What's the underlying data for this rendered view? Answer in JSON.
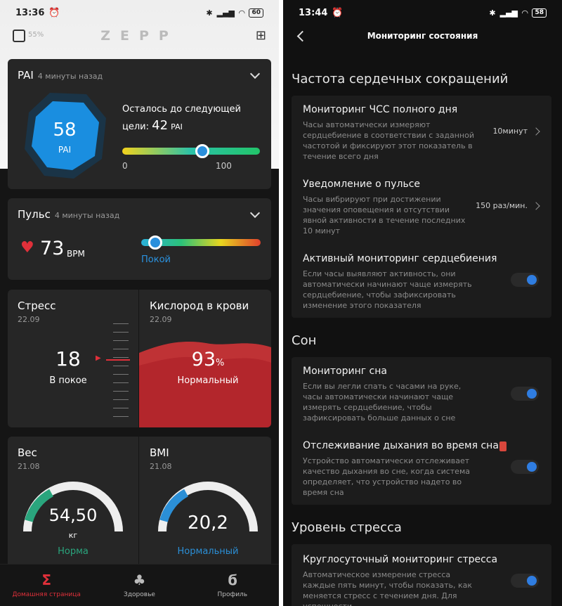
{
  "left": {
    "status": {
      "time": "13:36",
      "battery": "60"
    },
    "header": {
      "logo": "ZEPP",
      "device_battery": "55%"
    },
    "pai": {
      "title": "PAI",
      "time": "4 минуты назад",
      "value": "58",
      "unit": "PAI",
      "goal_text": "Осталось до следующей",
      "goal_prefix": "цели:",
      "goal_value": "42",
      "goal_unit": "PAI",
      "min": "0",
      "max": "100",
      "progress": 0.58
    },
    "pulse": {
      "title": "Пульс",
      "time": "4 минуты назад",
      "value": "73",
      "unit": "BPM",
      "status": "Покой",
      "level": 0.12
    },
    "stress": {
      "title": "Стресс",
      "date": "22.09",
      "value": "18",
      "status": "В покое"
    },
    "oxygen": {
      "title": "Кислород в крови",
      "date": "22.09",
      "value": "93",
      "unit": "%",
      "status": "Нормальный"
    },
    "weight": {
      "title": "Вес",
      "date": "21.08",
      "value": "54,50",
      "unit": "кг",
      "status": "Норма"
    },
    "bmi": {
      "title": "BMI",
      "date": "21.08",
      "value": "20,2",
      "status": "Нормальный"
    },
    "tabs": [
      {
        "label": "Домашняя страница",
        "icon": "Σ"
      },
      {
        "label": "Здоровье",
        "icon": "♣"
      },
      {
        "label": "Профиль",
        "icon": "ϭ"
      }
    ]
  },
  "right": {
    "status": {
      "time": "13:44",
      "battery": "58"
    },
    "title": "Мониторинг состояния",
    "sec1": "Частота сердечных сокращений",
    "hr_all_day": {
      "title": "Мониторинг ЧСС полного дня",
      "desc": "Часы автоматически измеряют сердцебиение в соответствии с заданной частотой и фиксируют этот показатель в течение всего дня",
      "value": "10минут"
    },
    "pulse_alert": {
      "title": "Уведомление о пульсе",
      "desc": "Часы вибрируют при достижении значения оповещения и отсутствии явной активности в течение последних 10 минут",
      "value": "150 раз/мин."
    },
    "active_hr": {
      "title": "Активный мониторинг сердцебиения",
      "desc": "Если часы выявляют активность, они автоматически начинают чаще измерять сердцебиение, чтобы зафиксировать изменение этого показателя"
    },
    "sec2": "Сон",
    "sleep": {
      "title": "Мониторинг сна",
      "desc": "Если вы легли спать с часами на руке, часы автоматически начинают чаще измерять сердцебиение, чтобы зафиксировать больше данных о сне"
    },
    "breath": {
      "title": "Отслеживание дыхания во время сна",
      "desc": "Устройство автоматически отслеживает качество дыхания во сне, когда система определяет, что устройство надето во время сна"
    },
    "sec3": "Уровень стресса",
    "stress_mon": {
      "title": "Круглосуточный мониторинг стресса",
      "desc": "Автоматическое измерение стресса каждые пять минут, чтобы показать, как меняется стресс с течением дня. Для успешности"
    }
  }
}
